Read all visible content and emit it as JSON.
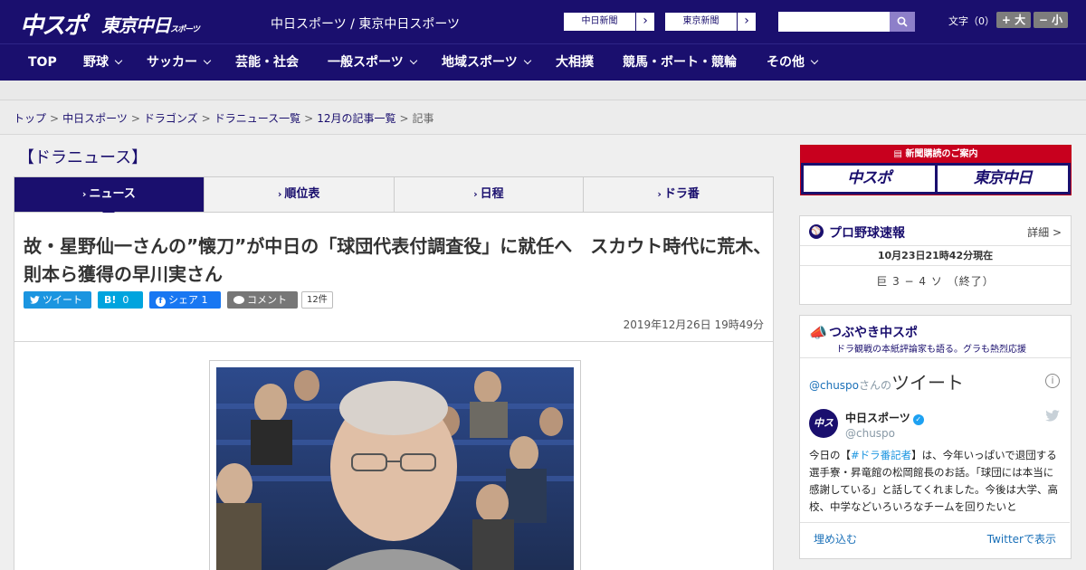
{
  "header": {
    "logo_chuspo": "中スポ",
    "logo_tokyo": "東京中日",
    "logo_tokyo_small": "スポーツ",
    "site_title": "中日スポーツ / 東京中日スポーツ",
    "ext_links": [
      {
        "label": "中日新聞"
      },
      {
        "label": "東京新聞"
      }
    ],
    "search": {
      "placeholder": "",
      "value": ""
    },
    "font_label": "文字（0）",
    "font_plus": "+ 大",
    "font_minus": "− 小"
  },
  "nav": {
    "items": [
      {
        "label": "TOP"
      },
      {
        "label": "野球"
      },
      {
        "label": "サッカー"
      },
      {
        "label": "芸能・社会"
      },
      {
        "label": "一般スポーツ"
      },
      {
        "label": "地域スポーツ"
      },
      {
        "label": "大相撲"
      },
      {
        "label": "競馬・ボート・競輪"
      },
      {
        "label": "その他"
      }
    ]
  },
  "breadcrumb": {
    "items": [
      "トップ",
      "中日スポーツ",
      "ドラゴンズ",
      "ドラニュース一覧",
      "12月の記事一覧"
    ],
    "current": "記事",
    "separator": ">"
  },
  "section_title": "【ドラニュース】",
  "tabs": [
    {
      "label": "ニュース"
    },
    {
      "label": "順位表"
    },
    {
      "label": "日程"
    },
    {
      "label": "ドラ番"
    }
  ],
  "article": {
    "headline": "故・星野仙一さんの”懐刀”が中日の「球団代表付調査役」に就任へ　スカウト時代に荒木、則本ら獲得の早川実さん",
    "share": {
      "tweet": "ツイート",
      "hatena": "B!",
      "hatena_count": "0",
      "facebook": "シェア",
      "facebook_count": "1",
      "comment": "コメント",
      "comment_count": "12件"
    },
    "date": "2019年12月26日 19時49分"
  },
  "sidebar": {
    "ad_top": "新聞購読のご案内",
    "ad_logo_left": "中スポ",
    "ad_logo_right": "東京中日",
    "baseball": {
      "title": "プロ野球速報",
      "more": "詳細 >",
      "time": "10月23日21時42分現在",
      "score": "巨 3 − 4 ソ （終了）"
    },
    "twitter": {
      "title": "つぶやき中スポ",
      "subtitle": "ドラ観戦の本紙評論家も語る。グラも熱烈応援",
      "header_handle": "@chuspo",
      "header_suffix": "さんの",
      "header_big": "ツイート",
      "account_name": "中日スポーツ",
      "account_handle": "@chuspo",
      "avatar_text": "中スポ",
      "body_pre": "今日の【",
      "body_tag": "#ドラ番記者",
      "body_post": "】は、今年いっぱいで退団する選手寮・昇竜館の松岡館長のお話。「球団には本当に感謝している」と話してくれました。今後は大学、高校、中学などいろいろなチームを回りたいと",
      "embed": "埋め込む",
      "view": "Twitterで表示"
    }
  },
  "colors": {
    "brand": "#1a0f6e",
    "ad_red": "#c8001e",
    "link": "#1a70b8"
  }
}
